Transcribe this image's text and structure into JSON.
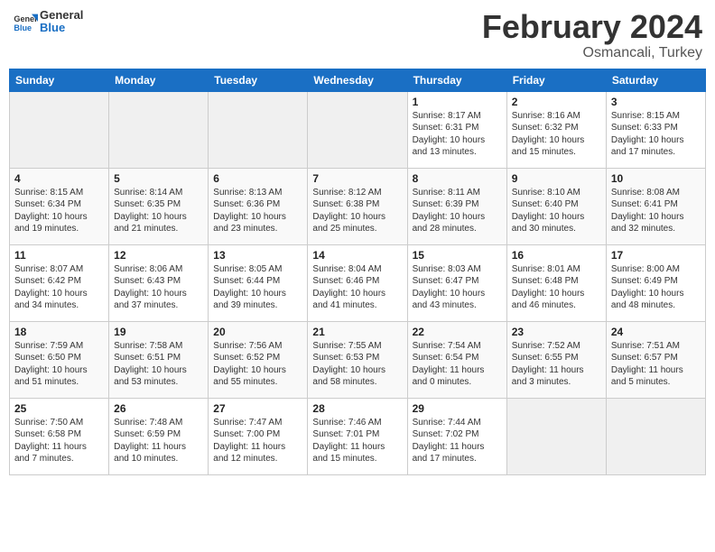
{
  "header": {
    "logo_general": "General",
    "logo_blue": "Blue",
    "month_title": "February 2024",
    "location": "Osmancali, Turkey"
  },
  "weekdays": [
    "Sunday",
    "Monday",
    "Tuesday",
    "Wednesday",
    "Thursday",
    "Friday",
    "Saturday"
  ],
  "weeks": [
    [
      {
        "day": "",
        "info": ""
      },
      {
        "day": "",
        "info": ""
      },
      {
        "day": "",
        "info": ""
      },
      {
        "day": "",
        "info": ""
      },
      {
        "day": "1",
        "info": "Sunrise: 8:17 AM\nSunset: 6:31 PM\nDaylight: 10 hours\nand 13 minutes."
      },
      {
        "day": "2",
        "info": "Sunrise: 8:16 AM\nSunset: 6:32 PM\nDaylight: 10 hours\nand 15 minutes."
      },
      {
        "day": "3",
        "info": "Sunrise: 8:15 AM\nSunset: 6:33 PM\nDaylight: 10 hours\nand 17 minutes."
      }
    ],
    [
      {
        "day": "4",
        "info": "Sunrise: 8:15 AM\nSunset: 6:34 PM\nDaylight: 10 hours\nand 19 minutes."
      },
      {
        "day": "5",
        "info": "Sunrise: 8:14 AM\nSunset: 6:35 PM\nDaylight: 10 hours\nand 21 minutes."
      },
      {
        "day": "6",
        "info": "Sunrise: 8:13 AM\nSunset: 6:36 PM\nDaylight: 10 hours\nand 23 minutes."
      },
      {
        "day": "7",
        "info": "Sunrise: 8:12 AM\nSunset: 6:38 PM\nDaylight: 10 hours\nand 25 minutes."
      },
      {
        "day": "8",
        "info": "Sunrise: 8:11 AM\nSunset: 6:39 PM\nDaylight: 10 hours\nand 28 minutes."
      },
      {
        "day": "9",
        "info": "Sunrise: 8:10 AM\nSunset: 6:40 PM\nDaylight: 10 hours\nand 30 minutes."
      },
      {
        "day": "10",
        "info": "Sunrise: 8:08 AM\nSunset: 6:41 PM\nDaylight: 10 hours\nand 32 minutes."
      }
    ],
    [
      {
        "day": "11",
        "info": "Sunrise: 8:07 AM\nSunset: 6:42 PM\nDaylight: 10 hours\nand 34 minutes."
      },
      {
        "day": "12",
        "info": "Sunrise: 8:06 AM\nSunset: 6:43 PM\nDaylight: 10 hours\nand 37 minutes."
      },
      {
        "day": "13",
        "info": "Sunrise: 8:05 AM\nSunset: 6:44 PM\nDaylight: 10 hours\nand 39 minutes."
      },
      {
        "day": "14",
        "info": "Sunrise: 8:04 AM\nSunset: 6:46 PM\nDaylight: 10 hours\nand 41 minutes."
      },
      {
        "day": "15",
        "info": "Sunrise: 8:03 AM\nSunset: 6:47 PM\nDaylight: 10 hours\nand 43 minutes."
      },
      {
        "day": "16",
        "info": "Sunrise: 8:01 AM\nSunset: 6:48 PM\nDaylight: 10 hours\nand 46 minutes."
      },
      {
        "day": "17",
        "info": "Sunrise: 8:00 AM\nSunset: 6:49 PM\nDaylight: 10 hours\nand 48 minutes."
      }
    ],
    [
      {
        "day": "18",
        "info": "Sunrise: 7:59 AM\nSunset: 6:50 PM\nDaylight: 10 hours\nand 51 minutes."
      },
      {
        "day": "19",
        "info": "Sunrise: 7:58 AM\nSunset: 6:51 PM\nDaylight: 10 hours\nand 53 minutes."
      },
      {
        "day": "20",
        "info": "Sunrise: 7:56 AM\nSunset: 6:52 PM\nDaylight: 10 hours\nand 55 minutes."
      },
      {
        "day": "21",
        "info": "Sunrise: 7:55 AM\nSunset: 6:53 PM\nDaylight: 10 hours\nand 58 minutes."
      },
      {
        "day": "22",
        "info": "Sunrise: 7:54 AM\nSunset: 6:54 PM\nDaylight: 11 hours\nand 0 minutes."
      },
      {
        "day": "23",
        "info": "Sunrise: 7:52 AM\nSunset: 6:55 PM\nDaylight: 11 hours\nand 3 minutes."
      },
      {
        "day": "24",
        "info": "Sunrise: 7:51 AM\nSunset: 6:57 PM\nDaylight: 11 hours\nand 5 minutes."
      }
    ],
    [
      {
        "day": "25",
        "info": "Sunrise: 7:50 AM\nSunset: 6:58 PM\nDaylight: 11 hours\nand 7 minutes."
      },
      {
        "day": "26",
        "info": "Sunrise: 7:48 AM\nSunset: 6:59 PM\nDaylight: 11 hours\nand 10 minutes."
      },
      {
        "day": "27",
        "info": "Sunrise: 7:47 AM\nSunset: 7:00 PM\nDaylight: 11 hours\nand 12 minutes."
      },
      {
        "day": "28",
        "info": "Sunrise: 7:46 AM\nSunset: 7:01 PM\nDaylight: 11 hours\nand 15 minutes."
      },
      {
        "day": "29",
        "info": "Sunrise: 7:44 AM\nSunset: 7:02 PM\nDaylight: 11 hours\nand 17 minutes."
      },
      {
        "day": "",
        "info": ""
      },
      {
        "day": "",
        "info": ""
      }
    ]
  ]
}
